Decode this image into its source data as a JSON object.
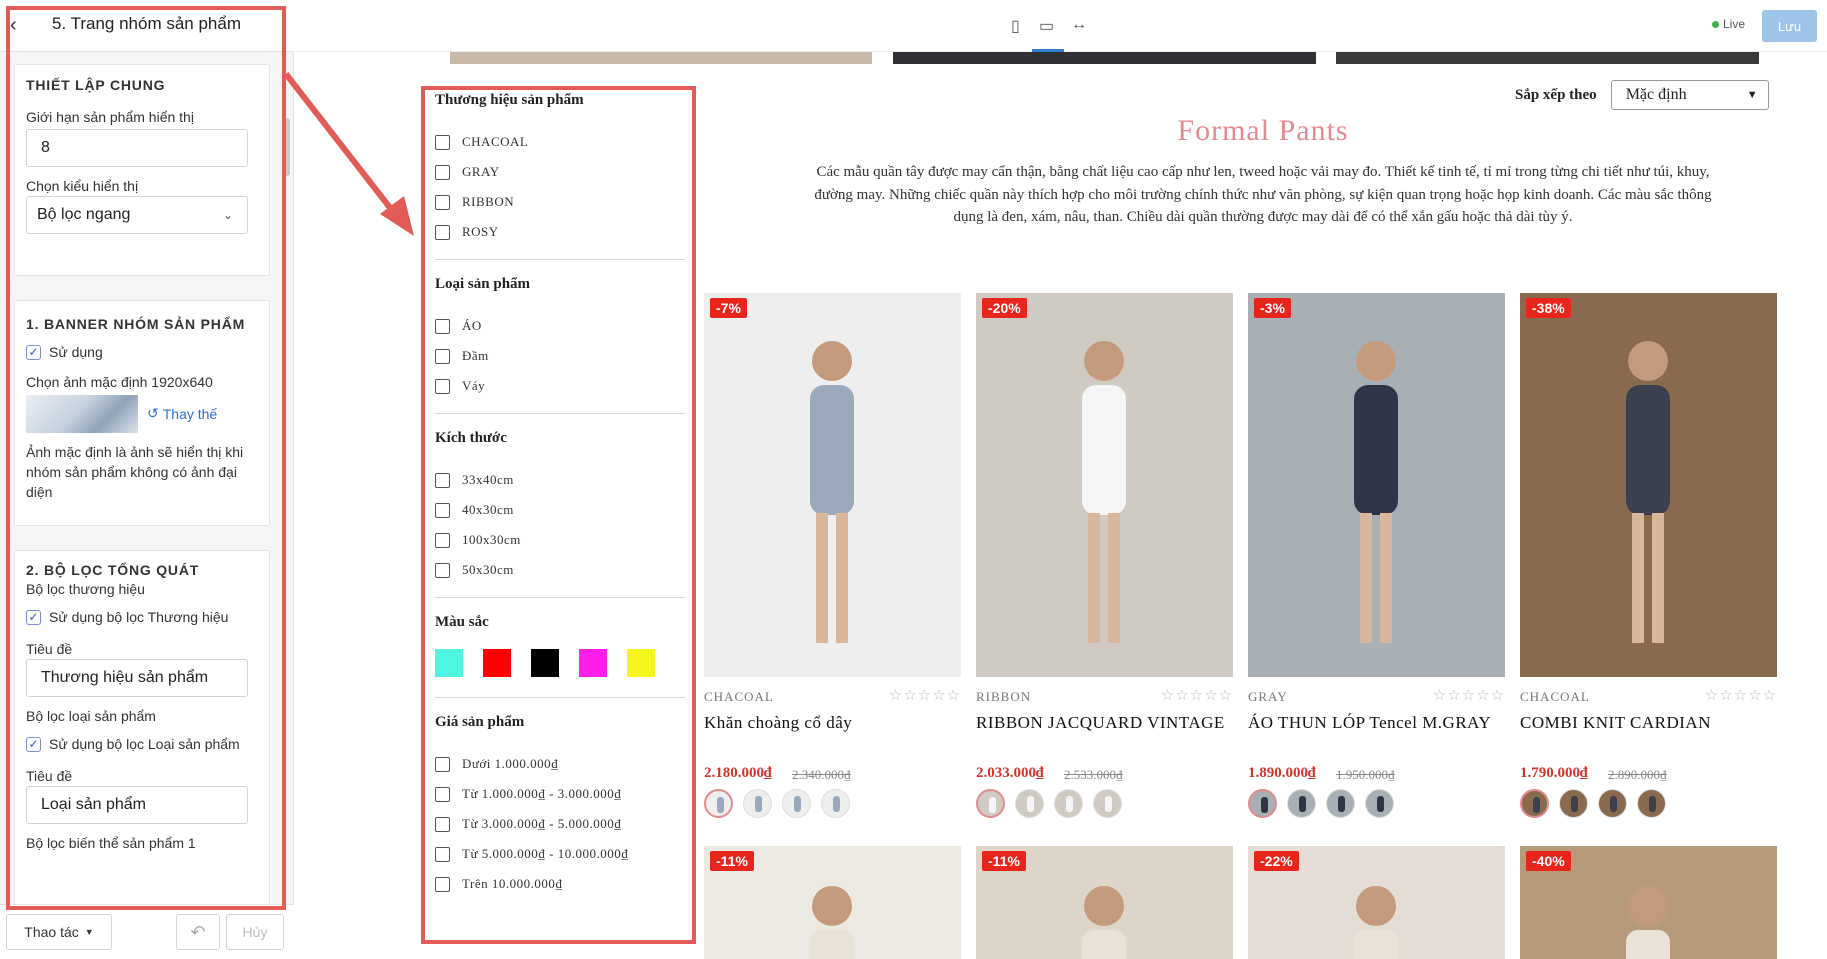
{
  "panel": {
    "back_icon": "chevron-left-icon",
    "title": "5. Trang nhóm sản phẩm",
    "general": {
      "heading": "THIẾT LẬP CHUNG",
      "limit_label": "Giới hạn sản phẩm hiển thị",
      "limit_value": "8",
      "display_label": "Chọn kiểu hiển thị",
      "display_value": "Bộ lọc ngang"
    },
    "banner": {
      "heading": "1. BANNER NHÓM SẢN PHẨM",
      "use_label": "Sử dụng",
      "use_checked": true,
      "image_label": "Chọn ảnh mặc định 1920x640",
      "replace_label": "Thay thế",
      "note": "Ảnh mặc định là ảnh sẽ hiển thị khi nhóm sản phẩm không có ảnh đại diện"
    },
    "filters": {
      "heading": "2. BỘ LỌC TỔNG QUÁT",
      "brand_label": "Bộ lọc thương hiệu",
      "brand_use_label": "Sử dụng bộ lọc Thương hiệu",
      "brand_title_label": "Tiêu đề",
      "brand_title_value": "Thương hiệu sản phẩm",
      "type_label": "Bộ lọc loại sản phẩm",
      "type_use_label": "Sử dụng bộ lọc Loại sản phẩm",
      "type_title_label": "Tiêu đề",
      "type_title_value": "Loại sản phẩm",
      "variant_label": "Bộ lọc biến thể sản phẩm 1"
    },
    "footer": {
      "actions_label": "Thao tác",
      "undo_icon": "undo-icon",
      "cancel_label": "Hủy"
    }
  },
  "topbar": {
    "device_icons": [
      "mobile-icon",
      "desktop-icon",
      "fullwidth-icon"
    ],
    "live_label": "Live",
    "save_label": "Lưu"
  },
  "store": {
    "sort_label": "Sắp xếp theo",
    "sort_value": "Mặc định",
    "collection_title": "Formal Pants",
    "collection_desc": "Các mẫu quần tây được may cẩn thận, bằng chất liệu cao cấp như len, tweed hoặc vải may đo. Thiết kế tinh tế, tỉ mỉ trong từng chi tiết như túi, khuy, đường may. Những chiếc quần này thích hợp cho môi trường chính thức như văn phòng, sự kiện quan trọng hoặc họp kinh doanh. Các màu sắc thông dụng là đen, xám, nâu, than. Chiều dài quần thường được may dài để có thể xắn gấu hoặc thả dài tùy ý.",
    "filter": {
      "brand_title": "Thương hiệu sản phẩm",
      "brands": [
        "CHACOAL",
        "GRAY",
        "RIBBON",
        "ROSY"
      ],
      "type_title": "Loại sản phẩm",
      "types": [
        "ÁO",
        "Đầm",
        "Váy"
      ],
      "size_title": "Kích thước",
      "sizes": [
        "33x40cm",
        "40x30cm",
        "100x30cm",
        "50x30cm"
      ],
      "color_title": "Màu sắc",
      "colors": [
        "#4ff5e0",
        "#ff0000",
        "#000000",
        "#ff1fe8",
        "#f5f51c"
      ],
      "price_title": "Giá sản phẩm",
      "prices": [
        "Dưới 1.000.000₫",
        "Từ 1.000.000₫ - 3.000.000₫",
        "Từ 3.000.000₫ - 5.000.000₫",
        "Từ 5.000.000₫ - 10.000.000₫",
        "Trên 10.000.000₫"
      ]
    },
    "products": [
      {
        "badge": "-7%",
        "brand": "CHACOAL",
        "name": "Khăn choàng cổ dây",
        "price": "2.180.000₫",
        "old_price": "2.340.000₫",
        "stars": "☆☆☆☆☆",
        "bg": "#eeeeee",
        "fig": "#9aa9bd"
      },
      {
        "badge": "-20%",
        "brand": "RIBBON",
        "name": "RIBBON JACQUARD VINTAGE",
        "price": "2.033.000₫",
        "old_price": "2.533.000₫",
        "stars": "☆☆☆☆☆",
        "bg": "#cfcac2",
        "fig": "#f5f5f5"
      },
      {
        "badge": "-3%",
        "brand": "GRAY",
        "name": "ÁO THUN LÓP Tencel M.GRAY",
        "price": "1.890.000₫",
        "old_price": "1.950.000₫",
        "stars": "☆☆☆☆☆",
        "bg": "#a8afb5",
        "fig": "#2f3547"
      },
      {
        "badge": "-38%",
        "brand": "CHACOAL",
        "name": "COMBI KNIT CARDIAN",
        "price": "1.790.000₫",
        "old_price": "2.890.000₫",
        "stars": "☆☆☆☆☆",
        "bg": "#8a6a4e",
        "fig": "#3c4150"
      }
    ],
    "products_row2": [
      {
        "badge": "-11%",
        "bg": "#ece8e2"
      },
      {
        "badge": "-11%",
        "bg": "#ddd5c8"
      },
      {
        "badge": "-22%",
        "bg": "#e3ddd6"
      },
      {
        "badge": "-40%",
        "bg": "#b79a7a"
      }
    ]
  }
}
